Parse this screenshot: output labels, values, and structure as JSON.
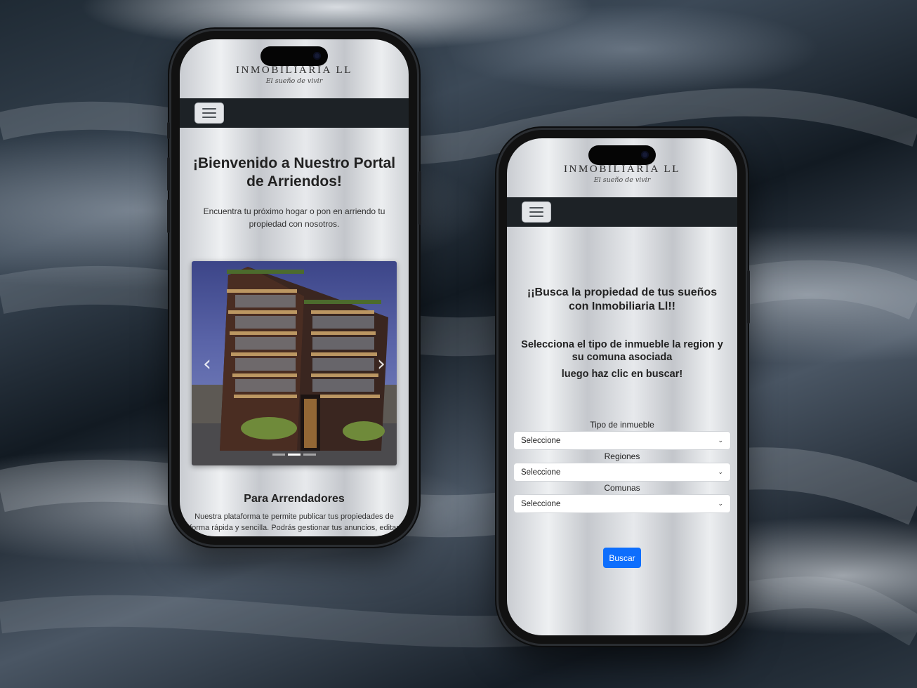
{
  "brand": {
    "name": "INMOBILIARIA LL",
    "tagline": "El sueño de vivir"
  },
  "home_page": {
    "welcome_title": "¡Bienvenido a Nuestro Portal de Arriendos!",
    "welcome_text": "Encuentra tu próximo hogar o pon en arriendo tu propiedad con nosotros.",
    "carousel": {
      "prev_icon": "chevron-left-icon",
      "next_icon": "chevron-right-icon",
      "slide_count": 3,
      "active_slide": 2
    },
    "owners_section": {
      "title": "Para Arrendadores",
      "text": "Nuestra plataforma te permite publicar tus propiedades de forma rápida y sencilla. Podrás gestionar tus anuncios, editar"
    }
  },
  "search_page": {
    "title": "¡¡Busca la propiedad de tus sueños con Inmobiliaria Ll!!",
    "instruction_line1": "Selecciona el tipo de inmueble la region y su comuna asociada",
    "instruction_line2": "luego haz clic en buscar!",
    "fields": [
      {
        "label": "Tipo de inmueble",
        "value": "Seleccione"
      },
      {
        "label": "Regiones",
        "value": "Seleccione"
      },
      {
        "label": "Comunas",
        "value": "Seleccione"
      }
    ],
    "search_button": "Buscar"
  },
  "colors": {
    "navbar": "#1d2226",
    "primary_button": "#0d6efd",
    "phone_frame": "#111111"
  }
}
